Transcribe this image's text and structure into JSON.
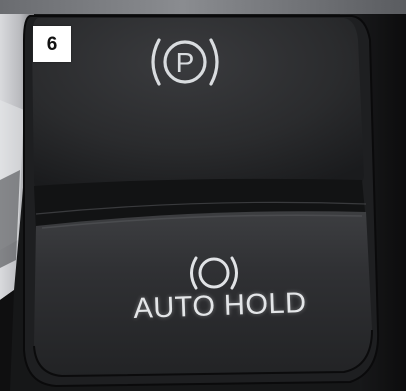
{
  "photo": {
    "step_badge": "6",
    "upper_button": {
      "icon": "parking-brake-icon",
      "symbol": "P"
    },
    "lower_button": {
      "icon": "auto-hold-icon",
      "label": "AUTO HOLD"
    }
  },
  "colors": {
    "badge_background": "#ffffff",
    "badge_text": "#111111",
    "panel_base": "#1c1d1f",
    "symbol_glow": "#d9dcdf"
  }
}
